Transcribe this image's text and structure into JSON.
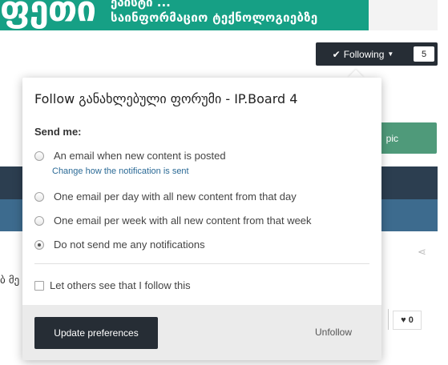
{
  "banner": {
    "logo": "ფეთი",
    "line1": "ეპისტი ...",
    "line2": "საინფორმაციო ტექნოლოგიებზე"
  },
  "header": {
    "following_label": "Following",
    "follower_count": "5",
    "start_topic_label": "pic"
  },
  "background": {
    "snippet": "ბ მე",
    "like_count": "0"
  },
  "popup": {
    "title": "Follow განახლებული ფორუმი - IP.Board 4",
    "send_me_label": "Send me:",
    "options": [
      {
        "label": "An email when new content is posted",
        "sublink": "Change how the notification is sent",
        "checked": false
      },
      {
        "label": "One email per day with all new content from that day",
        "checked": false
      },
      {
        "label": "One email per week with all new content from that week",
        "checked": false
      },
      {
        "label": "Do not send me any notifications",
        "checked": true
      }
    ],
    "anonymous_label": "Let others see that I follow this",
    "update_button": "Update preferences",
    "unfollow_label": "Unfollow"
  },
  "colors": {
    "banner": "#16a085",
    "dark_button": "#262d35",
    "dark_band": "#2c3e50",
    "blue_band": "#3d6b8e",
    "start_topic": "#4f9a7a",
    "link": "#2b6a96"
  }
}
